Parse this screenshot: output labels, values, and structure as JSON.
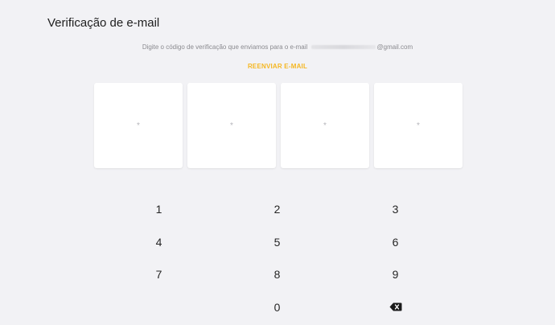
{
  "header": {
    "title": "Verificação de e-mail"
  },
  "instructions": {
    "prefix": "Digite o código de verificação que enviamos para o e-mail",
    "email_suffix": "@gmail.com"
  },
  "resend": {
    "label": "REENVIAR E-MAIL"
  },
  "code": {
    "placeholders": [
      "*",
      "*",
      "*",
      "*"
    ]
  },
  "keypad": {
    "keys": [
      "1",
      "2",
      "3",
      "4",
      "5",
      "6",
      "7",
      "8",
      "9",
      "",
      "0"
    ],
    "backspace_icon": "backspace-icon"
  },
  "colors": {
    "background": "#f2f2f5",
    "accent": "#f5b722",
    "box": "#ffffff"
  }
}
